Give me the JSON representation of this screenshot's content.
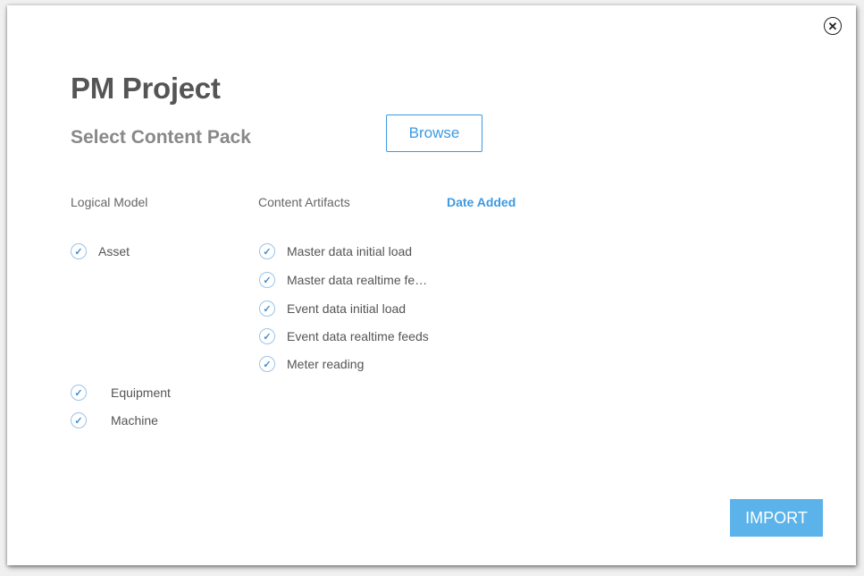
{
  "dialog": {
    "close_glyph": "✕",
    "title": "PM Project",
    "subtitle": "Select Content Pack",
    "browse_label": "Browse",
    "columns": {
      "logical_model": "Logical Model",
      "content_artifacts": "Content Artifacts",
      "date_added": "Date Added"
    },
    "logical_items": [
      {
        "label": "Asset",
        "checked": true
      },
      {
        "label": "Equipment",
        "checked": true
      },
      {
        "label": "Machine",
        "checked": true
      }
    ],
    "artifact_items": [
      {
        "label": "Master data initial load",
        "checked": true
      },
      {
        "label": "Master data realtime fe…",
        "checked": true
      },
      {
        "label": "Event data initial load",
        "checked": true
      },
      {
        "label": "Event data realtime feeds",
        "checked": true
      },
      {
        "label": "Meter reading",
        "checked": true
      }
    ],
    "import_label": "IMPORT"
  },
  "icons": {
    "close": "close-icon",
    "check": "check-circle-icon"
  },
  "colors": {
    "accent": "#3d9ae0",
    "import_button": "#5bb3ea",
    "title_text": "#555555",
    "subtitle_text": "#888888"
  }
}
